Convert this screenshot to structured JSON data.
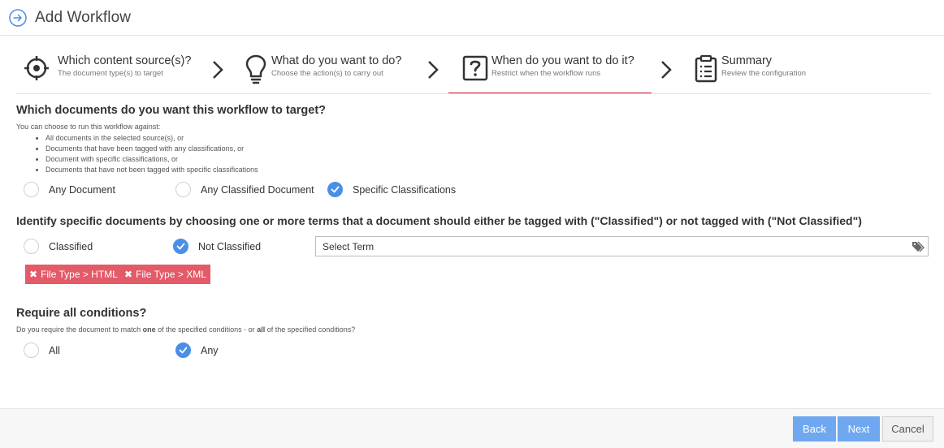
{
  "header": {
    "title": "Add Workflow",
    "icon": "arrow-right-circle-icon"
  },
  "steps": [
    {
      "title": "Which content source(s)?",
      "subtitle": "The document type(s) to target",
      "icon": "target-icon"
    },
    {
      "title": "What do you want to do?",
      "subtitle": "Choose the action(s) to carry out",
      "icon": "lightbulb-icon"
    },
    {
      "title": "When do you want to do it?",
      "subtitle": "Restrict when the workflow runs",
      "icon": "question-box-icon",
      "active": true
    },
    {
      "title": "Summary",
      "subtitle": "Review the configuration",
      "icon": "clipboard-list-icon"
    }
  ],
  "target": {
    "heading": "Which documents do you want this workflow to target?",
    "intro": "You can choose to run this workflow against:",
    "bullets": [
      "All documents in the selected source(s), or",
      "Documents that have been tagged with any classifications, or",
      "Document with specific classifications, or",
      "Documents that have not been tagged with specific classifications"
    ],
    "options": [
      {
        "label": "Any Document",
        "checked": false
      },
      {
        "label": "Any Classified Document",
        "checked": false
      },
      {
        "label": "Specific Classifications",
        "checked": true
      }
    ]
  },
  "identify": {
    "heading": "Identify specific documents by choosing one or more terms that a document should either be tagged with (\"Classified\") or not tagged with (\"Not Classified\")",
    "options": [
      {
        "label": "Classified",
        "checked": false
      },
      {
        "label": "Not Classified",
        "checked": true
      }
    ],
    "select_placeholder": "Select Term",
    "chips": [
      {
        "label": "File Type > HTML"
      },
      {
        "label": "File Type > XML"
      }
    ]
  },
  "conditions": {
    "heading": "Require all conditions?",
    "desc_part1": "Do you require the document to match ",
    "desc_one": "one",
    "desc_part2": " of the specified conditions - or ",
    "desc_all": "all",
    "desc_part3": " of the specified conditions?",
    "options": [
      {
        "label": "All",
        "checked": false
      },
      {
        "label": "Any",
        "checked": true
      }
    ]
  },
  "footer": {
    "back_label": "Back",
    "next_label": "Next",
    "cancel_label": "Cancel"
  },
  "colors": {
    "accent": "#4a8fe7",
    "active_step": "#c9203f",
    "chip": "#e35a69",
    "primary_button": "#6fa8f0"
  }
}
